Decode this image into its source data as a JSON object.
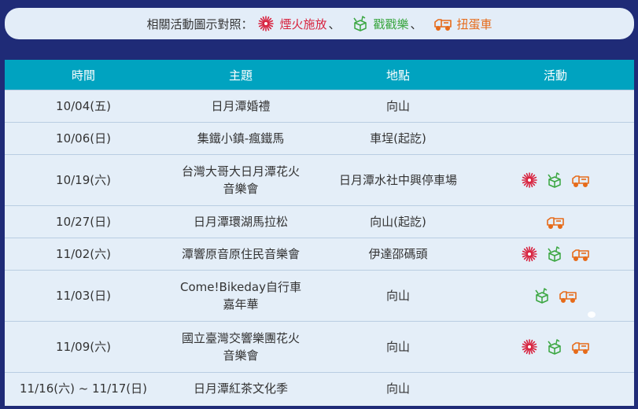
{
  "legend": {
    "label": "相關活動圖示對照：",
    "fireworks": "煙火施放",
    "fun": "戳戳樂",
    "egg": "扭蛋車",
    "sep": "、"
  },
  "table": {
    "headers": [
      "時間",
      "主題",
      "地點",
      "活動"
    ],
    "rows": [
      {
        "date": "10/04(五)",
        "topic": "日月潭婚禮",
        "place": "向山",
        "icons": []
      },
      {
        "date": "10/06(日)",
        "topic": "集鐵小鎮-瘋鐵馬",
        "place": "車埕(起訖)",
        "icons": []
      },
      {
        "date": "10/19(六)",
        "topic": "台灣大哥大日月潭花火\n音樂會",
        "place": "日月潭水社中興停車場",
        "icons": [
          "fireworks-icon",
          "fun-icon",
          "egg-truck-icon"
        ]
      },
      {
        "date": "10/27(日)",
        "topic": "日月潭環湖馬拉松",
        "place": "向山(起訖)",
        "icons": [
          "egg-truck-icon"
        ]
      },
      {
        "date": "11/02(六)",
        "topic": "潭響原音原住民音樂會",
        "place": "伊達邵碼頭",
        "icons": [
          "fireworks-icon",
          "fun-icon",
          "egg-truck-icon"
        ]
      },
      {
        "date": "11/03(日)",
        "topic": "Come!Bikeday自行車\n嘉年華",
        "place": "向山",
        "icons": [
          "fun-icon",
          "egg-truck-icon"
        ]
      },
      {
        "date": "11/09(六)",
        "topic": "國立臺灣交響樂團花火\n音樂會",
        "place": "向山",
        "icons": [
          "fireworks-icon",
          "fun-icon",
          "egg-truck-icon"
        ]
      },
      {
        "date": "11/16(六) ~ 11/17(日)",
        "topic": "日月潭紅茶文化季",
        "place": "向山",
        "icons": []
      }
    ]
  },
  "colors": {
    "background": "#1f2b77",
    "header": "#00a3c0",
    "fireworks": "#d8233f",
    "fun": "#3aa640",
    "egg": "#e66b1a"
  }
}
